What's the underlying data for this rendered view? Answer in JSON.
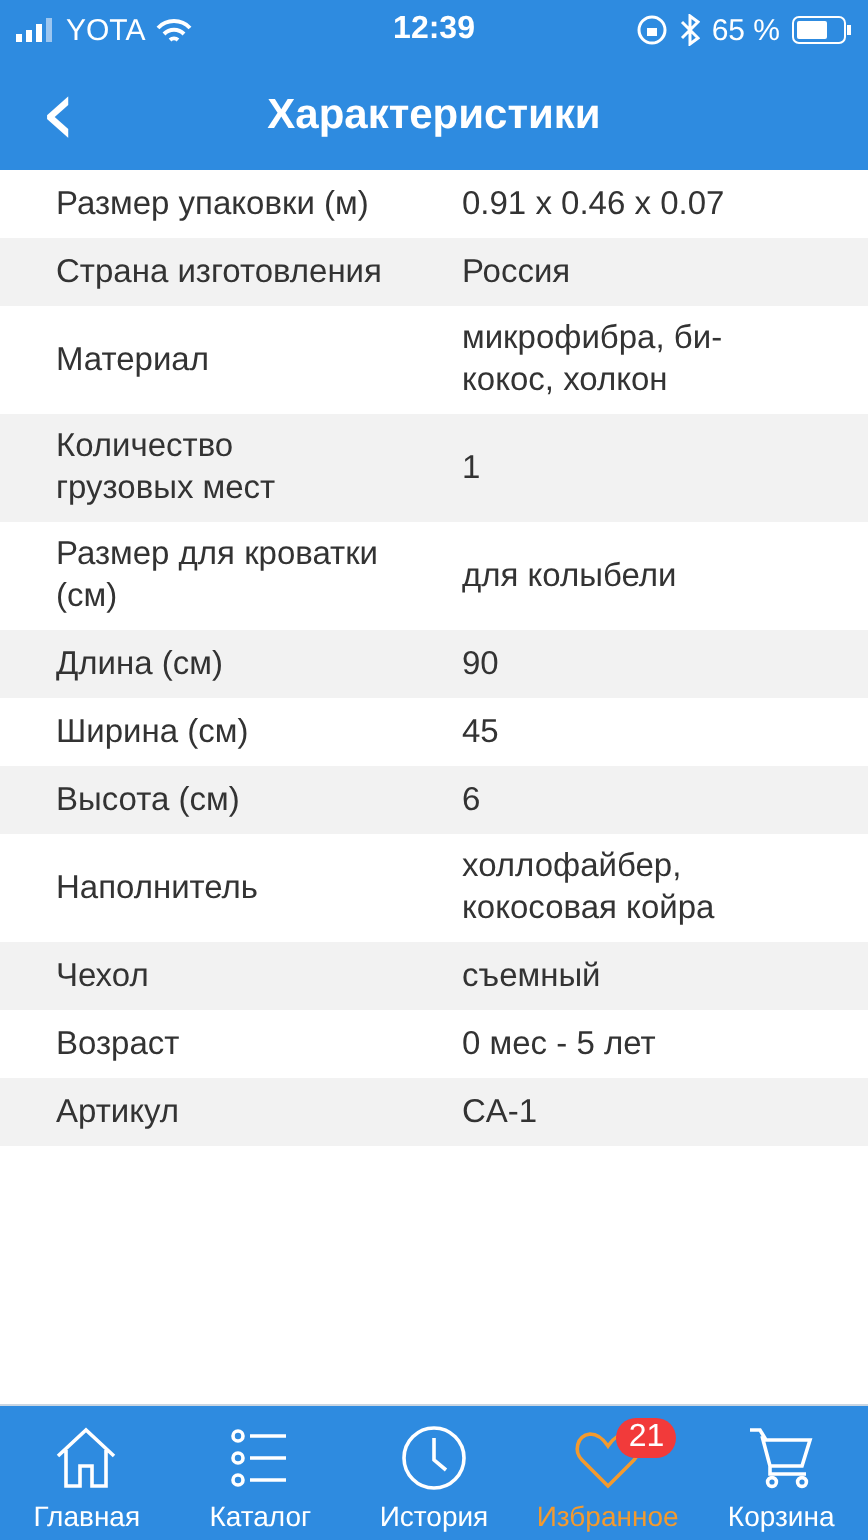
{
  "status_bar": {
    "carrier": "YOTA",
    "time": "12:39",
    "battery": "65 %"
  },
  "header": {
    "back": "‹",
    "title": "Характеристики"
  },
  "specs": [
    {
      "label": "Размер упаковки (м)",
      "value": "0.91 x 0.46 x 0.07"
    },
    {
      "label": "Страна изготовления",
      "value": "Россия"
    },
    {
      "label": "Материал",
      "value": "микрофибра, би-\nкокос, холкон"
    },
    {
      "label": "Количество\nгрузовых мест",
      "value": "1"
    },
    {
      "label": "Размер для кроватки\n(см)",
      "value": "для колыбели"
    },
    {
      "label": "Длина (см)",
      "value": "90"
    },
    {
      "label": "Ширина (см)",
      "value": "45"
    },
    {
      "label": "Высота (см)",
      "value": "6"
    },
    {
      "label": "Наполнитель",
      "value": "холлофайбер,\nкокосовая койра"
    },
    {
      "label": "Чехол",
      "value": "съемный"
    },
    {
      "label": "Возраст",
      "value": "0 мес - 5 лет"
    },
    {
      "label": "Артикул",
      "value": "CA-1"
    }
  ],
  "tabs": [
    {
      "kind": "home",
      "label": "Главная",
      "selected": false
    },
    {
      "kind": "catalog",
      "label": "Каталог",
      "selected": false
    },
    {
      "kind": "history",
      "label": "История",
      "selected": false
    },
    {
      "kind": "favorites",
      "label": "Избранное",
      "selected": true,
      "badge": "21"
    },
    {
      "kind": "cart",
      "label": "Корзина",
      "selected": false
    }
  ]
}
